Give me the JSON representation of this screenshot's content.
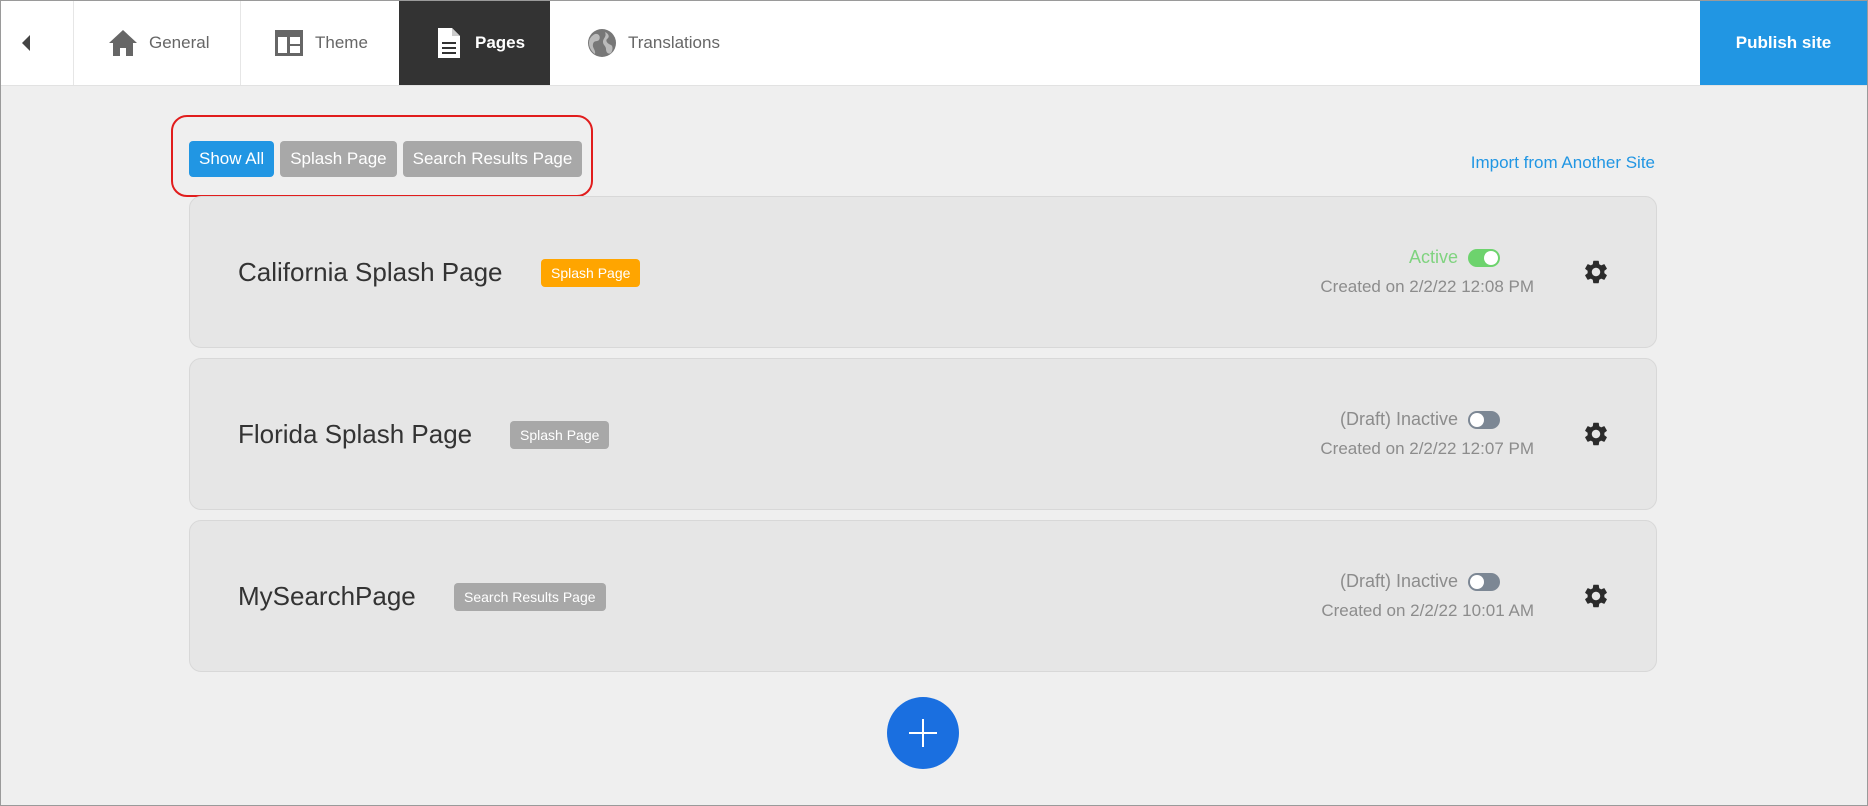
{
  "nav": {
    "back_icon": "caret-left-icon",
    "tabs": [
      {
        "label": "General",
        "icon": "home-icon",
        "active": false
      },
      {
        "label": "Theme",
        "icon": "layout-icon",
        "active": false
      },
      {
        "label": "Pages",
        "icon": "document-icon",
        "active": true
      },
      {
        "label": "Translations",
        "icon": "globe-icon",
        "active": false
      }
    ],
    "publish_label": "Publish site"
  },
  "filters": {
    "buttons": [
      {
        "label": "Show All",
        "active": true
      },
      {
        "label": "Splash Page",
        "active": false
      },
      {
        "label": "Search Results Page",
        "active": false
      }
    ],
    "import_link": "Import from Another Site"
  },
  "pages": [
    {
      "title": "California Splash Page",
      "type": "Splash Page",
      "badge_color": "#ffa500",
      "status": "Active",
      "active": true,
      "created": "Created on 2/2/22 12:08 PM"
    },
    {
      "title": "Florida Splash Page",
      "type": "Splash Page",
      "badge_color": "#a8a8a8",
      "status": "(Draft) Inactive",
      "active": false,
      "created": "Created on 2/2/22 12:07 PM"
    },
    {
      "title": "MySearchPage",
      "type": "Search Results Page",
      "badge_color": "#a8a8a8",
      "status": "(Draft) Inactive",
      "active": false,
      "created": "Created on 2/2/22 10:01 AM"
    }
  ],
  "colors": {
    "accent": "#2196e3",
    "active_tab_bg": "#333333",
    "add_button": "#1a6fe0",
    "active_status": "#7fd37f",
    "highlight_outline": "#e11d1d"
  },
  "add_button_icon": "plus-icon"
}
